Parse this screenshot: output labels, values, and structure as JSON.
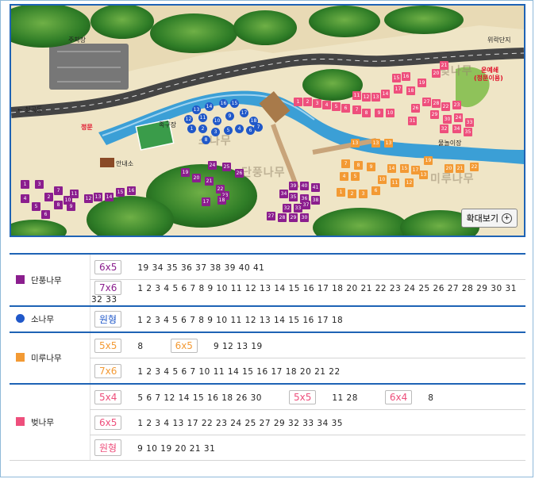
{
  "map": {
    "labels": {
      "parking": "주차장",
      "entrance_left": "← 청곡동",
      "gate": "정문",
      "info": "안내소",
      "football": "족구장",
      "destination_right": "위락단지",
      "annex": "운예쇄",
      "annex_note": "(정문이용)",
      "water_play": "물놀이장",
      "zoom": "확대보기"
    },
    "zones": {
      "sonamu": "소나무",
      "danpung": "단풍나무",
      "miru": "미루나무",
      "beot": "벚나무"
    },
    "colors": {
      "danpung": "#8b1e8e",
      "sonamu": "#2058c9",
      "miru": "#f39a34",
      "beot": "#ee4f7c"
    }
  },
  "legend": [
    {
      "name": "단풍나무",
      "color": "#8b1e8e",
      "swatch": "square",
      "rows": [
        {
          "groups": [
            {
              "size": "6x5",
              "nums": "19 34 35 36 37 38 39 40 41"
            }
          ]
        },
        {
          "groups": [
            {
              "size": "7x6",
              "nums": "1 2 3 4 5 6 7 8 9 10 11 12 13 14 15 16 17 18 20 21 22 23 24 25 26 27 28 29 30 31 32 33"
            }
          ]
        }
      ]
    },
    {
      "name": "소나무",
      "color": "#2058c9",
      "swatch": "circle",
      "rows": [
        {
          "groups": [
            {
              "size": "원형",
              "nums": "1 2 3 4 5 6 7 8 9 10 11 12 13 14 15 16 17 18"
            }
          ]
        }
      ]
    },
    {
      "name": "미루나무",
      "color": "#f39a34",
      "swatch": "square",
      "rows": [
        {
          "groups": [
            {
              "size": "5x5",
              "nums": "8"
            },
            {
              "size": "6x5",
              "nums": "9 12 13 19"
            }
          ]
        },
        {
          "groups": [
            {
              "size": "7x6",
              "nums": "1 2 3 4 5 6 7 10 11 14 15 16 17 18 20 21 22"
            }
          ]
        }
      ]
    },
    {
      "name": "벚나무",
      "color": "#ee4f7c",
      "swatch": "square",
      "rows": [
        {
          "groups": [
            {
              "size": "5x4",
              "nums": "5 6 7 12 14 15 16 18 26 30"
            },
            {
              "size": "5x5",
              "nums": "11 28"
            },
            {
              "size": "6x4",
              "nums": "8"
            }
          ]
        },
        {
          "groups": [
            {
              "size": "6x5",
              "nums": "1 2 3 4 13 17 22 23 24 25 27 29 32 33 34 35"
            }
          ]
        },
        {
          "groups": [
            {
              "size": "원형",
              "nums": "9 10 19 20 21 31"
            }
          ]
        }
      ]
    }
  ]
}
